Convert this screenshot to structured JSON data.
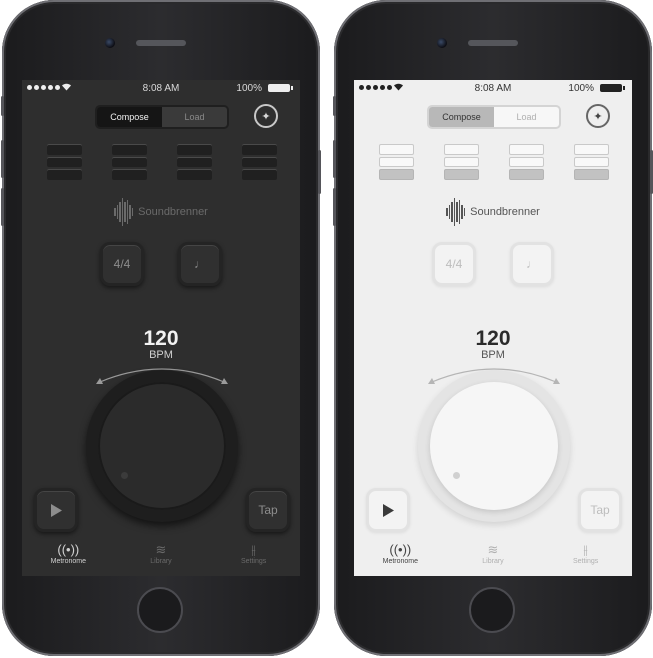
{
  "status_bar": {
    "time": "8:08 AM",
    "battery": "100%"
  },
  "header": {
    "segments": [
      {
        "label": "Compose",
        "active": true
      },
      {
        "label": "Load",
        "active": false
      }
    ],
    "compass_icon": "compass-icon"
  },
  "brand": {
    "name": "Soundbrenner"
  },
  "controls": {
    "time_signature": "4/4",
    "note_value": "♩",
    "tap_label": "Tap",
    "play_icon": "play-icon"
  },
  "tempo": {
    "value": "120",
    "unit": "BPM"
  },
  "tabs": [
    {
      "label": "Metronome",
      "icon": "metronome-icon",
      "active": true
    },
    {
      "label": "Library",
      "icon": "library-icon",
      "active": false
    },
    {
      "label": "Settings",
      "icon": "settings-icon",
      "active": false
    }
  ],
  "themes": {
    "dark": {
      "background": "#2e2e2e",
      "text": "#f2f2f2"
    },
    "light": {
      "background": "#efefef",
      "text": "#2b2b2b"
    }
  }
}
